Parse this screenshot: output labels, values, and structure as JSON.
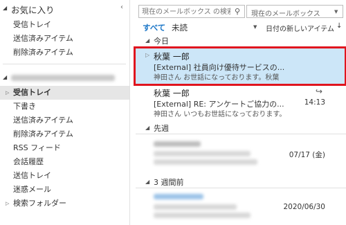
{
  "sidebar": {
    "favorites_label": "お気に入り",
    "favorites": [
      {
        "label": "受信トレイ"
      },
      {
        "label": "送信済みアイテム"
      },
      {
        "label": "削除済みアイテム"
      }
    ],
    "folders": [
      {
        "label": "受信トレイ",
        "selected": true
      },
      {
        "label": "下書き"
      },
      {
        "label": "送信済みアイテム"
      },
      {
        "label": "削除済みアイテム"
      },
      {
        "label": "RSS フィード"
      },
      {
        "label": "会話履歴"
      },
      {
        "label": "送信トレイ"
      },
      {
        "label": "迷惑メール"
      },
      {
        "label": "検索フォルダー"
      }
    ]
  },
  "search": {
    "placeholder": "現在のメールボックス の検索（Ctrl...",
    "scope": "現在のメールボックス"
  },
  "filters": {
    "all": "すべて",
    "unread": "未読",
    "sort": "日付の新しいアイテム",
    "sort_arrow": "↓"
  },
  "groups": {
    "today": "今日",
    "last_week": "先週",
    "three_weeks_ago": "3 週間前"
  },
  "messages": [
    {
      "sender": "秋葉 一郎",
      "subject": "[External]  社員向け優待サービスの...",
      "preview": "神田さん  お世話になっております。秋葉",
      "time": ""
    },
    {
      "sender": "秋葉 一郎",
      "subject": "[External]  RE: アンケートご協力の...",
      "preview": "神田さん  いつもお世話になっております。",
      "time": "14:13"
    },
    {
      "time": "07/17 (金)"
    },
    {
      "time": "2020/06/30"
    }
  ],
  "colors": {
    "accent": "#1e78c8",
    "selection": "#cce6f8",
    "highlight_border": "#e0141e"
  }
}
